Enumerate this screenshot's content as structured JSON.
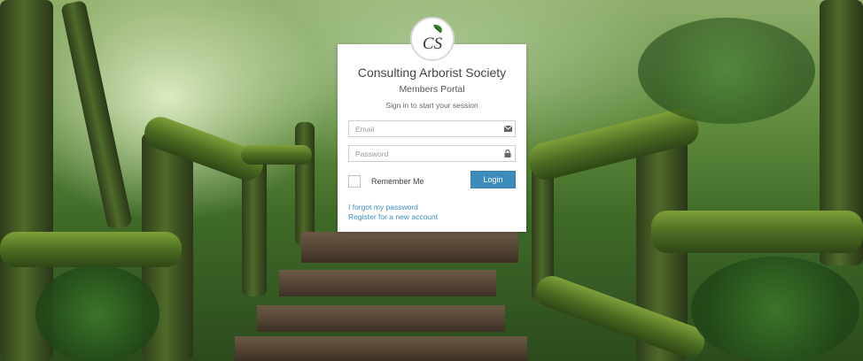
{
  "brand": {
    "logo_letters": "CS",
    "title": "Consulting Arborist Society",
    "subtitle": "Members Portal",
    "tagline": "Sign in to start your session"
  },
  "form": {
    "email": {
      "placeholder": "Email",
      "value": "",
      "icon": "envelope-icon"
    },
    "password": {
      "placeholder": "Password",
      "value": "",
      "icon": "lock-icon"
    },
    "remember_label": "Remember Me",
    "remember_checked": false,
    "login_label": "Login"
  },
  "links": {
    "forgot": "I forgot my password",
    "register": "Register for a new account"
  },
  "colors": {
    "accent": "#3c8dbc",
    "logo_green": "#3a7d2a"
  }
}
